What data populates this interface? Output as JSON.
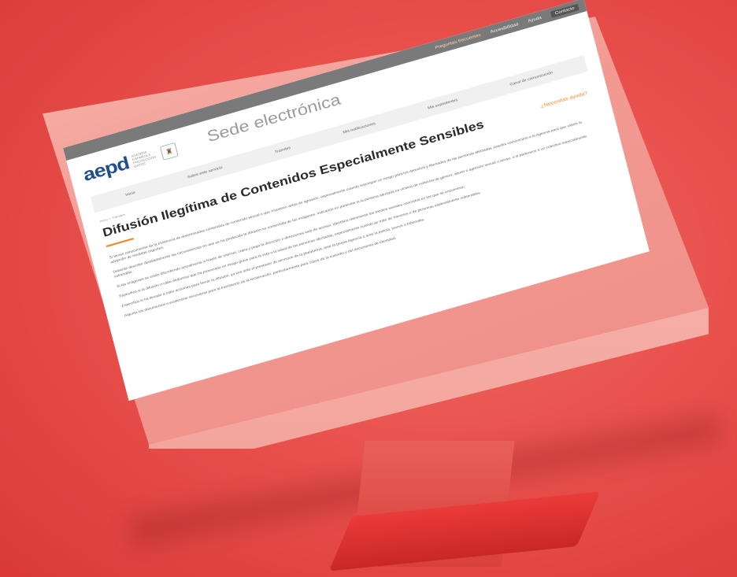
{
  "topbar": {
    "link1": "Preguntas frecuentes",
    "link2": "Accesibilidad",
    "link3": "Ayuda",
    "button": "Contacto"
  },
  "header": {
    "logo_text": "aepd",
    "logo_subtitle": "AGENCIA ESPAÑOLA PROTECCIÓN DATOS",
    "site_title": "Sede electrónica"
  },
  "nav": {
    "items": [
      "Inicio",
      "Sobre este servicio",
      "Trámites",
      "Mis notificaciones",
      "Mis expedientes",
      "Canal de comunicación"
    ]
  },
  "breadcrumb": "Inicio  >  Trámites",
  "page_title": "Difusión Ilegítima de Contenidos Especialmente Sensibles",
  "orange_link": "¿Necesitas ayuda?",
  "paragraphs": [
    "Si tienes conocimiento de la existencia de determinados contenidos de contenido sexual o que muestren actos de agresión, especialmente cuando supongan un riesgo para los derechos y libertades de las personas afectadas, puedes comunicarlo a la Agencia para que valore la adopción de medidas urgentes.",
    "Deberás describir detalladamente las circunstancias en que se ha producido la difusión no consentida de las imágenes, indicando en particular si la persona afectada es víctima de violencia de género, abuso o agresión sexual o acoso, o si pertenece a un colectivo especialmente vulnerable.",
    "Si las imágenes se están difundiendo actualmente a través de internet, copia y pega la dirección o direcciones web de acceso. Identifica claramente los medios sociales concretos en los que se encuentran.",
    "Especifica si la difusión o cabe deducirse que ha provocado un riesgo grave para la vida o la salud de las personas afectadas, especialmente cuando se trate de menores o de personas especialmente vulnerables.",
    "Especifica si ha llevado a cabo acciones para frenar la difusión, ya sea ante el prestador de servicios de la plataforma, ante la propia Agencia o ante la policía, jueces o tribunales.",
    "Adjunta los documentos o evidencias necesarias para la tramitación de la reclamación, particularmente para casos de la custodia y del documento de identidad."
  ]
}
